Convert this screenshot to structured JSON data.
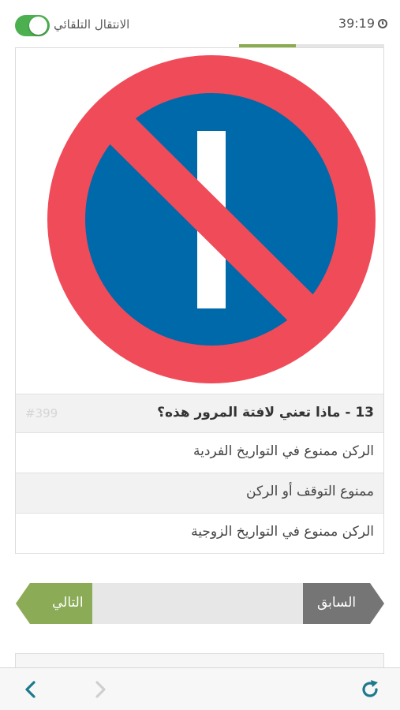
{
  "header": {
    "auto_advance_label": "الانتقال التلقائي",
    "auto_advance_on": true,
    "timer": "39:19",
    "progress_fraction": 0.39
  },
  "question": {
    "text": "13 - ماذا تعني لافتة المرور هذه؟",
    "id": "#399",
    "sign_icon": "no-parking-odd-dates-sign"
  },
  "answers": [
    "الركن ممنوع في التواريخ الفردية",
    "ممنوع التوقف أو الركن",
    "الركن ممنوع في التواريخ الزوجية"
  ],
  "nav": {
    "previous_label": "السابق",
    "next_label": "التالي"
  },
  "toolbar": {
    "back_icon": "chevron-left-icon",
    "forward_icon": "chevron-right-icon",
    "reload_icon": "refresh-icon"
  },
  "colors": {
    "accent_green": "#8bab57",
    "toggle_green": "#4caf50",
    "sign_red": "#f04b59",
    "sign_blue": "#0069aa",
    "toolbar_teal": "#1d7a8c"
  }
}
